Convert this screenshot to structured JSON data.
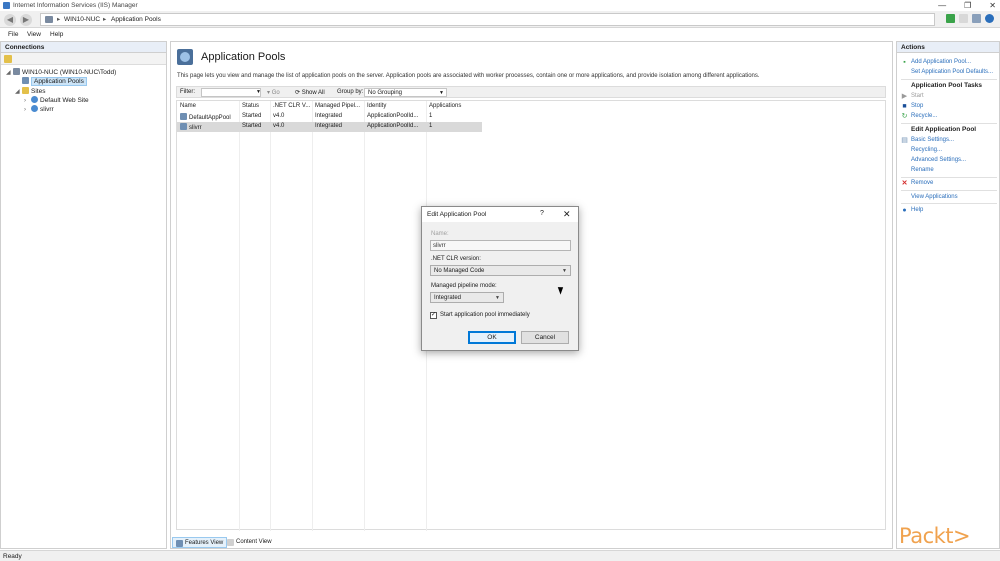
{
  "window": {
    "title": "Internet Information Services (IIS) Manager",
    "controls": [
      "—",
      "❐",
      "✕"
    ]
  },
  "address": {
    "crumbs": [
      "WIN10-NUC",
      "Application Pools"
    ],
    "separator": "▸"
  },
  "menu": [
    "File",
    "View",
    "Help"
  ],
  "connections": {
    "header": "Connections",
    "tree": [
      {
        "label": "WIN10-NUC (WIN10-NUC\\Todd)",
        "expander": "◢"
      },
      {
        "label": "Application Pools",
        "expander": ""
      },
      {
        "label": "Sites",
        "expander": "◢"
      },
      {
        "label": "Default Web Site",
        "expander": "›"
      },
      {
        "label": "slivrr",
        "expander": "›"
      }
    ]
  },
  "content": {
    "title": "Application Pools",
    "description": "This page lets you view and manage the list of application pools on the server. Application pools are associated with worker processes, contain one or more applications, and provide isolation among different applications.",
    "filter_label": "Filter:",
    "go_label": "Go",
    "show_all_label": "Show All",
    "group_by_label": "Group by:",
    "group_by_value": "No Grouping",
    "columns": [
      "Name",
      "Status",
      ".NET CLR V...",
      "Managed Pipel...",
      "Identity",
      "Applications"
    ],
    "rows": [
      {
        "name": "DefaultAppPool",
        "status": "Started",
        "clr": "v4.0",
        "pipeline": "Integrated",
        "identity": "ApplicationPoolId...",
        "applications": "1"
      },
      {
        "name": "slivrr",
        "status": "Started",
        "clr": "v4.0",
        "pipeline": "Integrated",
        "identity": "ApplicationPoolId...",
        "applications": "1"
      }
    ],
    "tabs": [
      "Features View",
      "Content View"
    ]
  },
  "actions": {
    "header": "Actions",
    "add_pool": "Add Application Pool...",
    "set_defaults": "Set Application Pool Defaults...",
    "tasks_header": "Application Pool Tasks",
    "start": "Start",
    "stop": "Stop",
    "recycle": "Recycle...",
    "edit_header": "Edit Application Pool",
    "basic_settings": "Basic Settings...",
    "recycling": "Recycling...",
    "advanced_settings": "Advanced Settings...",
    "rename": "Rename",
    "remove": "Remove",
    "view_applications": "View Applications",
    "help": "Help"
  },
  "dialog": {
    "title": "Edit Application Pool",
    "help_glyph": "?",
    "close_glyph": "✕",
    "name_label": "Name:",
    "name_value": "slivrr",
    "clr_label": ".NET CLR version:",
    "clr_value": "No Managed Code",
    "pipeline_label": "Managed pipeline mode:",
    "pipeline_value": "Integrated",
    "start_immediately_label": "Start application pool immediately",
    "start_immediately_checked": "✓",
    "ok_label": "OK",
    "cancel_label": "Cancel"
  },
  "status": {
    "text": "Ready"
  },
  "watermark": "Packt>",
  "colors": {
    "link": "#2a6ebb",
    "selection": "#cce4f7",
    "watermark": "#f0a24e",
    "stop_icon": "#1a4f99",
    "remove_icon": "#d42a2a"
  }
}
